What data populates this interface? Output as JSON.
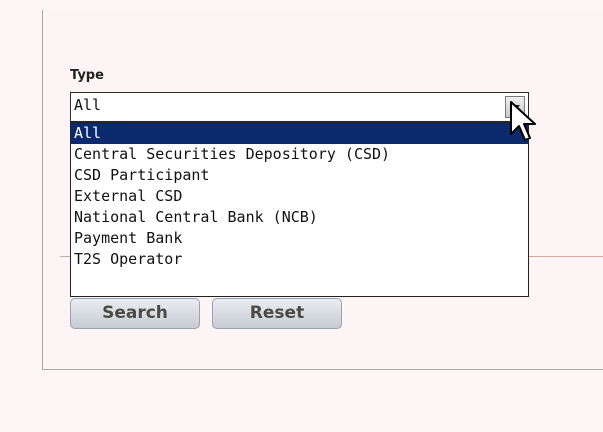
{
  "form": {
    "type_label": "Type",
    "type_select": {
      "value": "All",
      "options": [
        "All",
        "Central Securities Depository (CSD)",
        "CSD Participant",
        "External CSD",
        "National Central Bank (NCB)",
        "Payment Bank",
        "T2S Operator"
      ],
      "highlighted_index": 0
    },
    "search_label": "Search",
    "reset_label": "Reset"
  },
  "colors": {
    "highlight": "#0b2a6e",
    "background": "#fdf6f6",
    "divider": "#d9a6a6"
  },
  "icons": {
    "dropdown_arrow": "chevron-down-icon",
    "cursor": "mouse-pointer-icon"
  }
}
